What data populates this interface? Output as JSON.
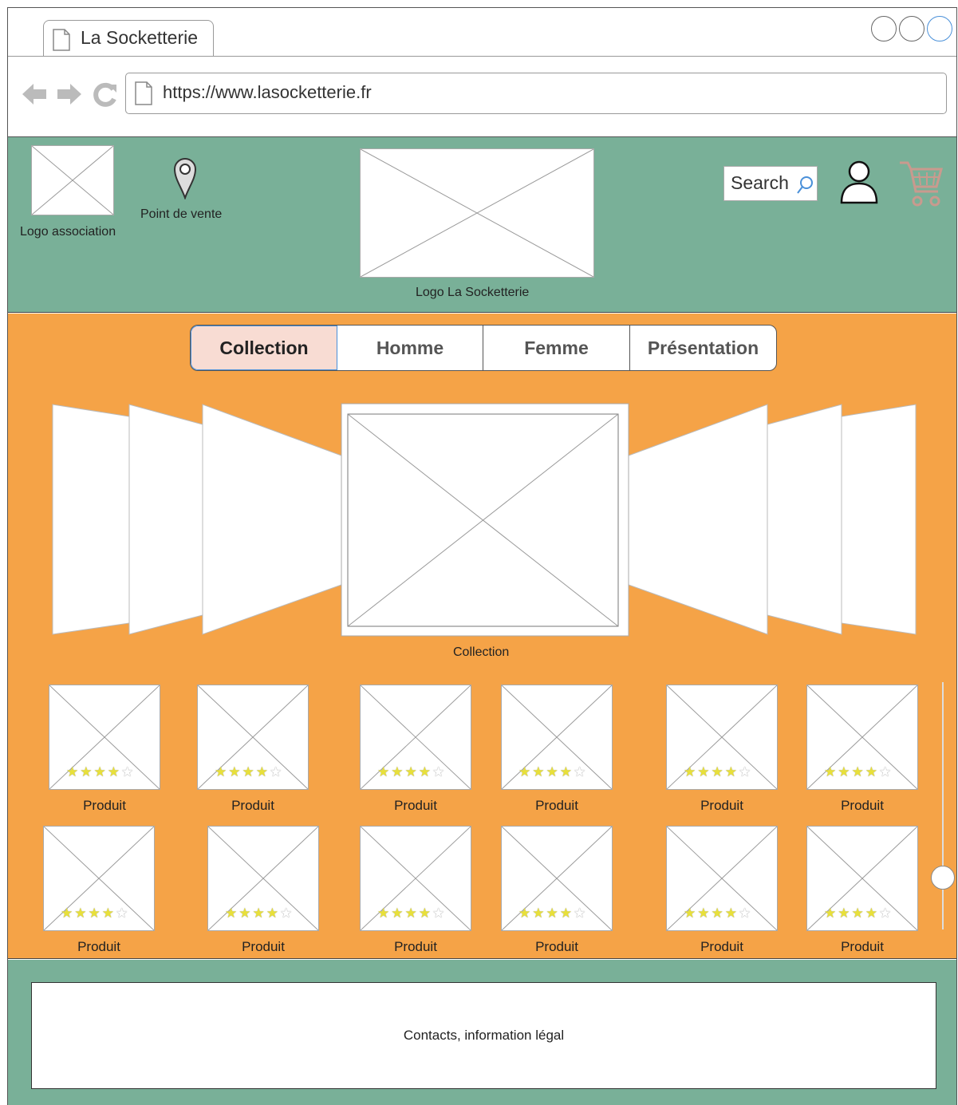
{
  "browser": {
    "tab_title": "La Socketterie",
    "url": "https://www.lasocketterie.fr"
  },
  "header": {
    "logo_association_label": "Logo association",
    "point_de_vente_label": "Point de vente",
    "logo_main_label": "Logo La Socketterie",
    "search_label": "Search"
  },
  "nav": {
    "items": [
      {
        "label": "Collection",
        "active": true
      },
      {
        "label": "Homme",
        "active": false
      },
      {
        "label": "Femme",
        "active": false
      },
      {
        "label": "Présentation",
        "active": false
      }
    ]
  },
  "carousel": {
    "caption": "Collection"
  },
  "products": {
    "row1": [
      {
        "label": "Produit",
        "rating": 4
      },
      {
        "label": "Produit",
        "rating": 4
      },
      {
        "label": "Produit",
        "rating": 4
      },
      {
        "label": "Produit",
        "rating": 4
      },
      {
        "label": "Produit",
        "rating": 4
      },
      {
        "label": "Produit",
        "rating": 4
      }
    ],
    "row2": [
      {
        "label": "Produit",
        "rating": 4
      },
      {
        "label": "Produit",
        "rating": 4
      },
      {
        "label": "Produit",
        "rating": 4
      },
      {
        "label": "Produit",
        "rating": 4
      },
      {
        "label": "Produit",
        "rating": 4
      },
      {
        "label": "Produit",
        "rating": 4
      }
    ]
  },
  "footer": {
    "text": "Contacts, information légal"
  },
  "colors": {
    "header_bg": "#79b098",
    "main_bg": "#f5a347",
    "active_tab_bg": "#f8dcd3"
  }
}
